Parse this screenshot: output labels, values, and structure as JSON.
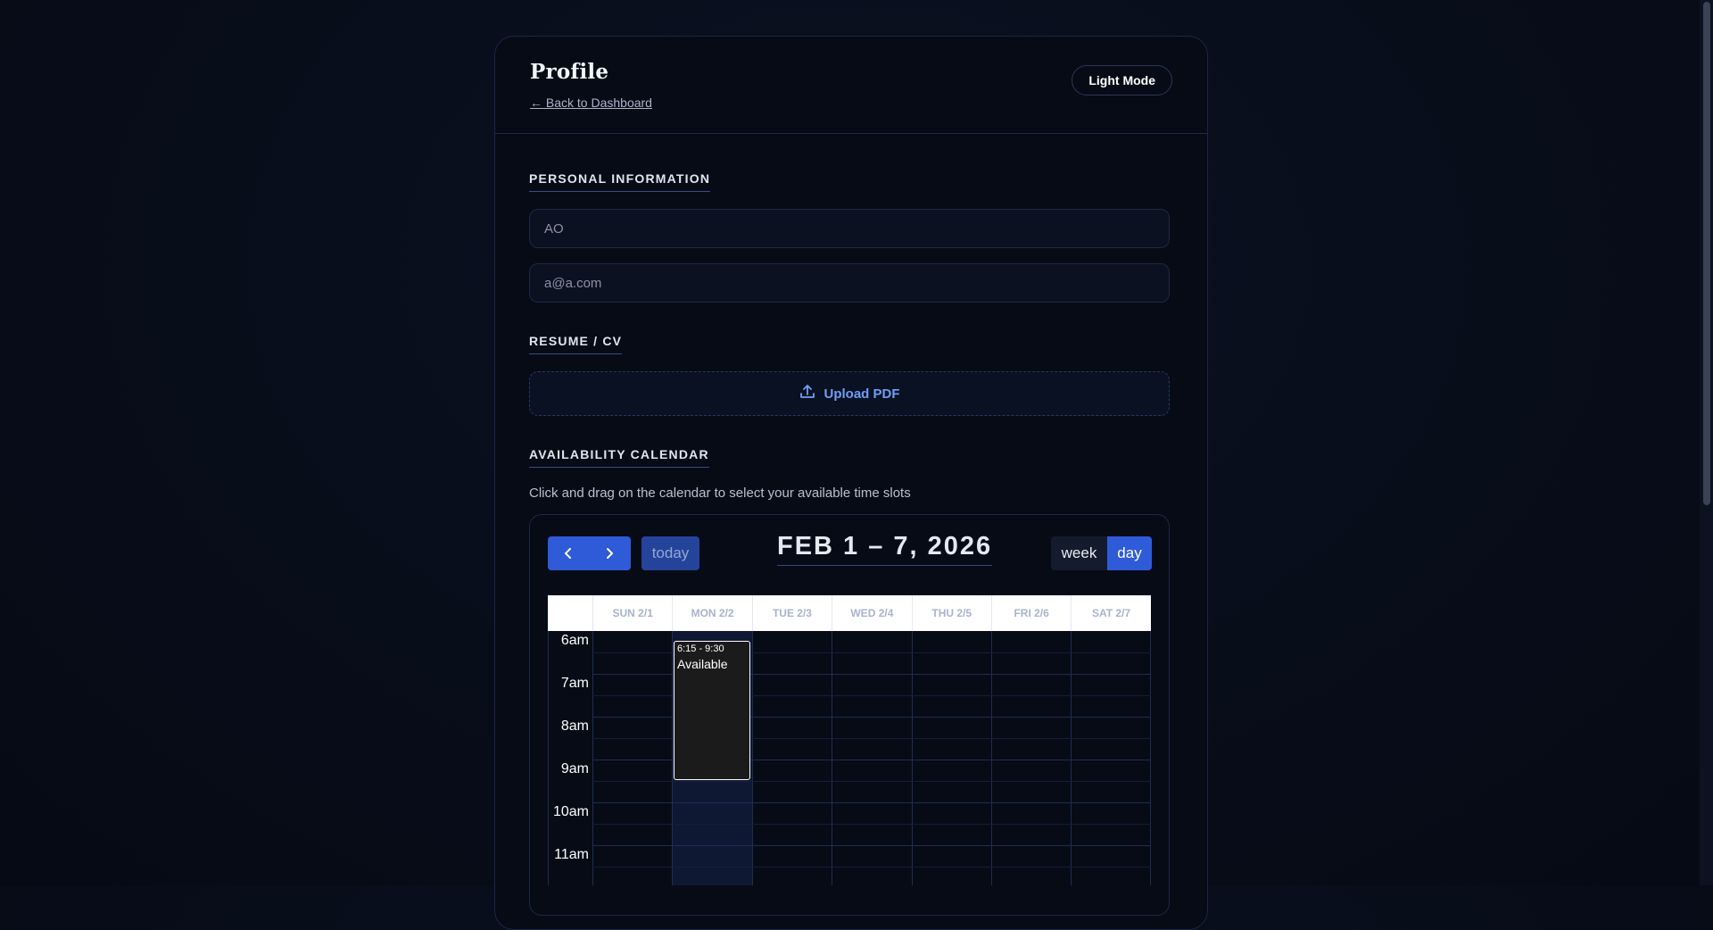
{
  "header": {
    "title": "Profile",
    "back_link": "← Back to Dashboard",
    "mode_button": "Light Mode"
  },
  "personal": {
    "label": "PERSONAL INFORMATION",
    "name_value": "AO",
    "email_value": "a@a.com"
  },
  "resume": {
    "label": "RESUME / CV",
    "upload_label": "Upload PDF",
    "upload_icon": "upload-icon"
  },
  "calendar": {
    "label": "AVAILABILITY CALENDAR",
    "helper": "Click and drag on the calendar to select your available time slots",
    "title": "FEB 1 – 7, 2026",
    "today_label": "today",
    "view_week": "week",
    "view_day": "day",
    "prev_icon": "chevron-left-icon",
    "next_icon": "chevron-right-icon",
    "days": [
      "SUN 2/1",
      "MON 2/2",
      "TUE 2/3",
      "WED 2/4",
      "THU 2/5",
      "FRI 2/6",
      "SAT 2/7"
    ],
    "times": [
      "6am",
      "7am",
      "8am",
      "9am",
      "10am",
      "11am"
    ],
    "highlighted_day": "MON 2/2",
    "event": {
      "time": "6:15 - 9:30",
      "title": "Available"
    },
    "colors": {
      "accent": "#2f5bd9",
      "today_bg": "#24439b",
      "event_bg": "#1b1b1b"
    }
  }
}
